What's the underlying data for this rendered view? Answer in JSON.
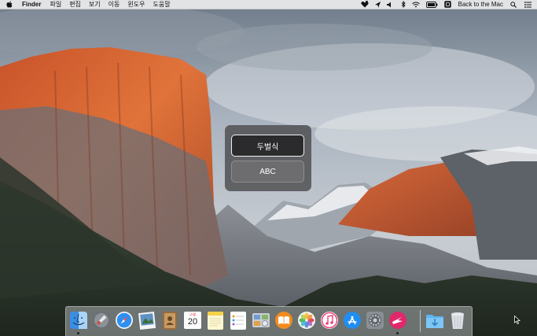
{
  "menubar": {
    "app_name": "Finder",
    "menus": [
      "파일",
      "편집",
      "보기",
      "이동",
      "윈도우",
      "도움말"
    ],
    "clock": "Back to the Mac",
    "status_icons": [
      "apple-logo-icon",
      "heart-status-icon",
      "location-arrow-icon",
      "volume-icon",
      "bluetooth-icon",
      "wifi-icon",
      "battery-icon",
      "keyboard-input-icon",
      "spotlight-icon",
      "notification-center-icon"
    ]
  },
  "input_switcher": {
    "options": [
      "두벌식",
      "ABC"
    ],
    "selected": "두벌식"
  },
  "dock": {
    "calendar": {
      "month": "10월",
      "day": "20"
    },
    "apps": [
      "Finder",
      "Launchpad",
      "Safari",
      "Preview",
      "Contacts",
      "Calendar",
      "Notes",
      "Reminders",
      "Photo Booth",
      "iBooks",
      "Photos",
      "iTunes",
      "App Store",
      "System Preferences",
      "Skitch",
      "Downloads",
      "Trash"
    ]
  },
  "colors": {
    "menubar_bg": "#ececec",
    "switcher_bg": "#464648",
    "selection_border": "#f2f2f2"
  }
}
